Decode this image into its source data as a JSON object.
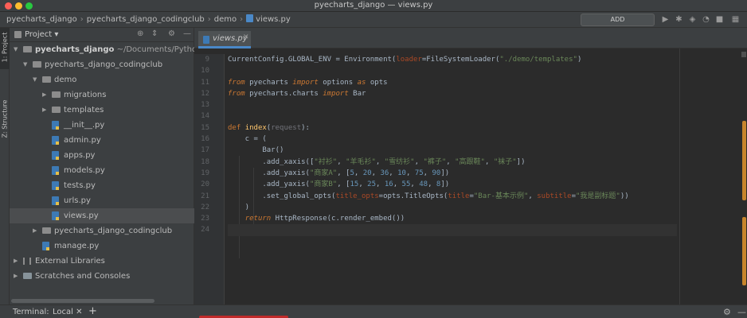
{
  "window": {
    "title": "pyecharts_django — views.py"
  },
  "navbar": {
    "breadcrumbs": [
      "pyecharts_django",
      "pyecharts_django_codingclub",
      "demo",
      "views.py"
    ],
    "config_button": "ADD CONFIGURATION..."
  },
  "stripe": {
    "project_label": "1: Project",
    "structure_label": "Z: Structure"
  },
  "project_panel": {
    "title": "Project",
    "tree": [
      {
        "label": "pyecharts_django",
        "path": "~/Documents/Python/cl/pyec",
        "level": 0,
        "expanded": true,
        "kind": "folder"
      },
      {
        "label": "pyecharts_django_codingclub",
        "level": 1,
        "expanded": true,
        "kind": "folder"
      },
      {
        "label": "demo",
        "level": 2,
        "expanded": true,
        "kind": "folder"
      },
      {
        "label": "migrations",
        "level": 3,
        "expanded": false,
        "kind": "folder"
      },
      {
        "label": "templates",
        "level": 3,
        "expanded": false,
        "kind": "folder"
      },
      {
        "label": "__init__.py",
        "level": 3,
        "kind": "file"
      },
      {
        "label": "admin.py",
        "level": 3,
        "kind": "file"
      },
      {
        "label": "apps.py",
        "level": 3,
        "kind": "file"
      },
      {
        "label": "models.py",
        "level": 3,
        "kind": "file"
      },
      {
        "label": "tests.py",
        "level": 3,
        "kind": "file"
      },
      {
        "label": "urls.py",
        "level": 3,
        "kind": "file"
      },
      {
        "label": "views.py",
        "level": 3,
        "kind": "file",
        "selected": true
      },
      {
        "label": "pyecharts_django_codingclub",
        "level": 2,
        "expanded": false,
        "kind": "folder"
      },
      {
        "label": "manage.py",
        "level": 2,
        "kind": "file"
      },
      {
        "label": "External Libraries",
        "level": 0,
        "expanded": false,
        "kind": "library"
      },
      {
        "label": "Scratches and Consoles",
        "level": 0,
        "expanded": false,
        "kind": "scratch"
      }
    ]
  },
  "editor": {
    "tab_label": "views.py",
    "line_numbers": [
      "9",
      "10",
      "11",
      "12",
      "13",
      "14",
      "15",
      "16",
      "17",
      "18",
      "19",
      "20",
      "21",
      "22",
      "23",
      "24"
    ],
    "code_lines": [
      [
        [
          "CurrentConfig.GLOBAL_ENV = Environment(",
          ""
        ],
        [
          "loader",
          "param"
        ],
        [
          "=FileSystemLoader(",
          ""
        ],
        [
          "\"./demo/templates\"",
          "str"
        ],
        [
          ")",
          ""
        ]
      ],
      [],
      [
        [
          "from",
          "kw"
        ],
        [
          " pyecharts ",
          ""
        ],
        [
          "import",
          "kw"
        ],
        [
          " options ",
          ""
        ],
        [
          "as",
          "kw"
        ],
        [
          " opts",
          ""
        ]
      ],
      [
        [
          "from",
          "kw"
        ],
        [
          " pyecharts.charts ",
          ""
        ],
        [
          "import",
          "kw"
        ],
        [
          " Bar",
          ""
        ]
      ],
      [],
      [],
      [
        [
          "def",
          "kwn"
        ],
        [
          " ",
          ""
        ],
        [
          "index",
          "fn"
        ],
        [
          "(",
          ""
        ],
        [
          "request",
          "unused"
        ],
        [
          "):",
          ""
        ]
      ],
      [
        [
          "    c = (",
          ""
        ]
      ],
      [
        [
          "        Bar()",
          ""
        ]
      ],
      [
        [
          "        .add_xaxis([",
          ""
        ],
        [
          "\"衬衫\"",
          "str"
        ],
        [
          ", ",
          ""
        ],
        [
          "\"羊毛衫\"",
          "str"
        ],
        [
          ", ",
          ""
        ],
        [
          "\"雪纺衫\"",
          "str"
        ],
        [
          ", ",
          ""
        ],
        [
          "\"裤子\"",
          "str"
        ],
        [
          ", ",
          ""
        ],
        [
          "\"高跟鞋\"",
          "str"
        ],
        [
          ", ",
          ""
        ],
        [
          "\"袜子\"",
          "str"
        ],
        [
          "])",
          ""
        ]
      ],
      [
        [
          "        .add_yaxis(",
          ""
        ],
        [
          "\"商家A\"",
          "str"
        ],
        [
          ", [",
          ""
        ],
        [
          "5",
          "num"
        ],
        [
          ", ",
          ""
        ],
        [
          "20",
          "num"
        ],
        [
          ", ",
          ""
        ],
        [
          "36",
          "num"
        ],
        [
          ", ",
          ""
        ],
        [
          "10",
          "num"
        ],
        [
          ", ",
          ""
        ],
        [
          "75",
          "num"
        ],
        [
          ", ",
          ""
        ],
        [
          "90",
          "num"
        ],
        [
          "])",
          ""
        ]
      ],
      [
        [
          "        .add_yaxis(",
          ""
        ],
        [
          "\"商家B\"",
          "str"
        ],
        [
          ", [",
          ""
        ],
        [
          "15",
          "num"
        ],
        [
          ", ",
          ""
        ],
        [
          "25",
          "num"
        ],
        [
          ", ",
          ""
        ],
        [
          "16",
          "num"
        ],
        [
          ", ",
          ""
        ],
        [
          "55",
          "num"
        ],
        [
          ", ",
          ""
        ],
        [
          "48",
          "num"
        ],
        [
          ", ",
          ""
        ],
        [
          "8",
          "num"
        ],
        [
          "])",
          ""
        ]
      ],
      [
        [
          "        .set_global_opts(",
          ""
        ],
        [
          "title_opts",
          "param"
        ],
        [
          "=opts.TitleOpts(",
          ""
        ],
        [
          "title",
          "param"
        ],
        [
          "=",
          ""
        ],
        [
          "\"Bar-基本示例\"",
          "str"
        ],
        [
          ", ",
          ""
        ],
        [
          "subtitle",
          "param"
        ],
        [
          "=",
          ""
        ],
        [
          "\"我是副标题\"",
          "str"
        ],
        [
          "))",
          ""
        ]
      ],
      [
        [
          "    )",
          ""
        ]
      ],
      [
        [
          "    ",
          ""
        ],
        [
          "return",
          "kw"
        ],
        [
          " HttpResponse(c.render_embed())",
          ""
        ]
      ],
      []
    ],
    "current_line_index": 15
  },
  "bottom_bar": {
    "terminal_label": "Terminal:",
    "terminal_tab": "Local",
    "add_label": "+"
  },
  "colors": {
    "accent": "#4a88c7",
    "keyword": "#cc7832",
    "string": "#6a8759",
    "number": "#6897bb",
    "function": "#ffc66d"
  }
}
